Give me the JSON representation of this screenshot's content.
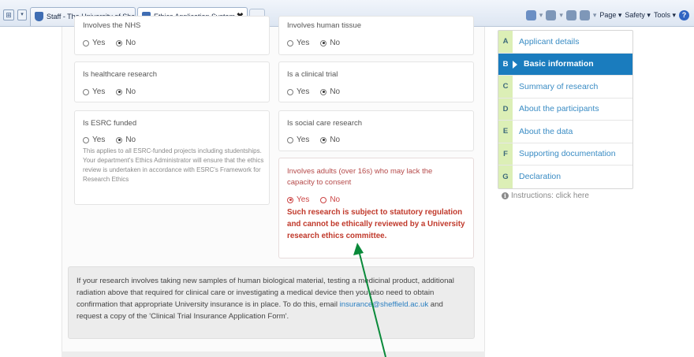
{
  "browser": {
    "tabs": [
      {
        "title": "Staff - The University of She...",
        "active": false
      },
      {
        "title": "Ethics Application System...",
        "active": true
      }
    ],
    "tab_close_glyph": "✖",
    "tab_list_glyph": "▾",
    "quick_tabs_glyph": "⊞",
    "commands": {
      "page": "Page ▾",
      "safety": "Safety ▾",
      "tools": "Tools ▾",
      "help": "?"
    },
    "icons": [
      "home-icon",
      "feeds-icon",
      "mail-icon",
      "print-icon",
      "help-icon"
    ]
  },
  "form": {
    "cards": [
      {
        "id": "nhs",
        "label": "Involves the NHS",
        "options": [
          "Yes",
          "No"
        ],
        "selected": "No"
      },
      {
        "id": "human_tissue",
        "label": "Involves human tissue",
        "options": [
          "Yes",
          "No"
        ],
        "selected": "No"
      },
      {
        "id": "healthcare",
        "label": "Is healthcare research",
        "options": [
          "Yes",
          "No"
        ],
        "selected": "No"
      },
      {
        "id": "clinical_trial",
        "label": "Is a clinical trial",
        "options": [
          "Yes",
          "No"
        ],
        "selected": "No"
      },
      {
        "id": "esrc",
        "label": "Is ESRC funded",
        "options": [
          "Yes",
          "No"
        ],
        "selected": "No",
        "help": "This applies to all ESRC-funded projects including studentships. Your department's Ethics Administrator will ensure that the ethics review is undertaken in accordance with ESRC's Framework for Research Ethics"
      },
      {
        "id": "social_care",
        "label": "Is social care research",
        "options": [
          "Yes",
          "No"
        ],
        "selected": "No"
      },
      {
        "id": "adults_capacity",
        "label": "Involves adults (over 16s) who may lack the capacity to consent",
        "options": [
          "Yes",
          "No"
        ],
        "selected": "Yes",
        "warning": "Such research is subject to statutory regulation and cannot be ethically reviewed by a University research ethics committee."
      }
    ],
    "insurance_note": {
      "text_before": "If your research involves taking new samples of human biological material, testing a medicinal product, additional radiation above that required for clinical care or investigating a medical device then you also need to obtain confirmation that appropriate University insurance is in place. To do this, email ",
      "email": "insurance@sheffield.ac.uk",
      "text_after": " and request a copy of the 'Clinical Trial Insurance Application Form'."
    }
  },
  "sidebar": {
    "items": [
      {
        "letter": "A",
        "label": "Applicant details",
        "active": false
      },
      {
        "letter": "B",
        "label": "Basic information",
        "active": true
      },
      {
        "letter": "C",
        "label": "Summary of research",
        "active": false
      },
      {
        "letter": "D",
        "label": "About the participants",
        "active": false
      },
      {
        "letter": "E",
        "label": "About the data",
        "active": false
      },
      {
        "letter": "F",
        "label": "Supporting documentation",
        "active": false
      },
      {
        "letter": "G",
        "label": "Declaration",
        "active": false
      }
    ],
    "instructions": "Instructions: click here",
    "instructions_icon_glyph": "i"
  },
  "colors": {
    "accent": "#1a7cbe",
    "warning": "#c0392b",
    "nav_letter_bg": "#dcefb6",
    "link": "#2a7fc1",
    "annotation_arrow": "#0a8a3a"
  }
}
